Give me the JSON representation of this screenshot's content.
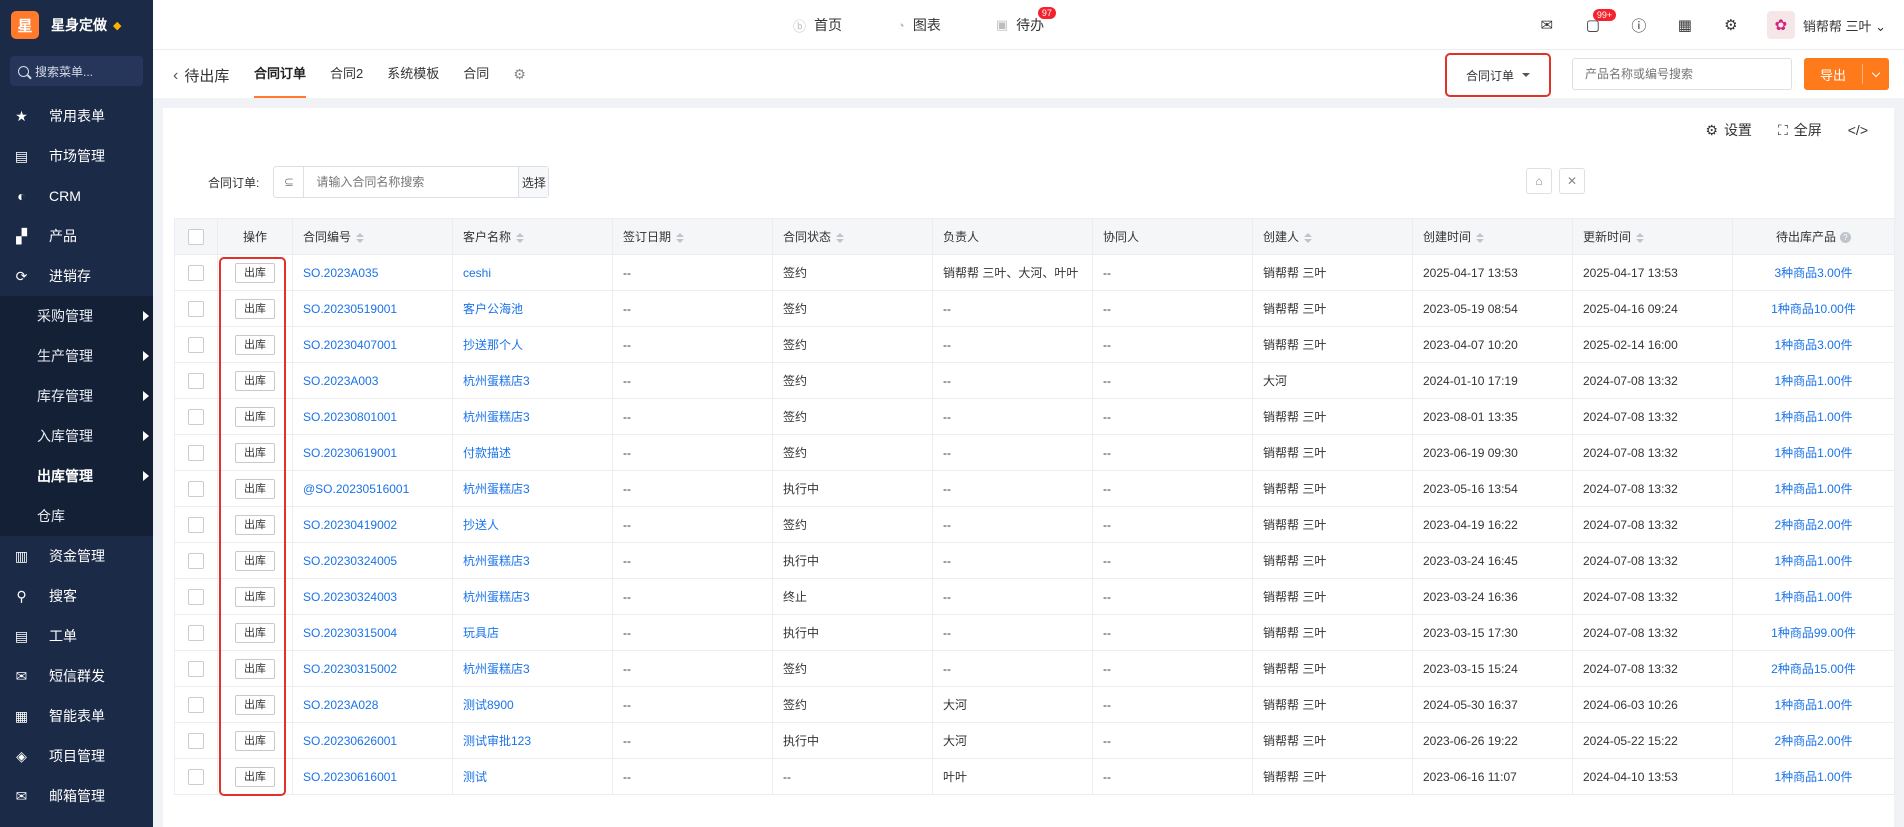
{
  "brand": {
    "logo_char": "星",
    "name": "星身定做"
  },
  "sidebar": {
    "search_placeholder": "搜索菜单...",
    "items": [
      {
        "label": "常用表单",
        "icon": "star-icon"
      },
      {
        "label": "市场管理",
        "icon": "clipboard-icon"
      },
      {
        "label": "CRM",
        "icon": "pie-icon"
      },
      {
        "label": "产品",
        "icon": "cube-icon"
      },
      {
        "label": "进销存",
        "icon": "refresh-icon"
      }
    ],
    "sub_items": [
      {
        "label": "采购管理",
        "arrow": true
      },
      {
        "label": "生产管理",
        "arrow": true
      },
      {
        "label": "库存管理",
        "arrow": true
      },
      {
        "label": "入库管理",
        "arrow": true
      },
      {
        "label": "出库管理",
        "arrow": true,
        "active": true
      },
      {
        "label": "仓库",
        "arrow": false
      }
    ],
    "items_after": [
      {
        "label": "资金管理",
        "icon": "wallet-icon"
      },
      {
        "label": "搜客",
        "icon": "search-icon"
      },
      {
        "label": "工单",
        "icon": "ticket-icon"
      },
      {
        "label": "短信群发",
        "icon": "envelope-icon"
      },
      {
        "label": "智能表单",
        "icon": "form-icon"
      },
      {
        "label": "项目管理",
        "icon": "layers-icon"
      },
      {
        "label": "邮箱管理",
        "icon": "mail-icon"
      }
    ]
  },
  "topbar": {
    "nav": [
      {
        "label": "首页",
        "icon": "home-icon"
      },
      {
        "label": "图表",
        "icon": "chart-icon"
      },
      {
        "label": "待办",
        "icon": "todo-icon",
        "badge": "97"
      }
    ],
    "message_badge": "99+",
    "user_name": "销帮帮 三叶"
  },
  "tabsbar": {
    "back_label": "待出库",
    "tabs": [
      "合同订单",
      "合同2",
      "系统模板",
      "合同"
    ],
    "active_tab": "合同订单",
    "dropdown_value": "合同订单",
    "search_placeholder": "产品名称或编号搜索",
    "export_label": "导出"
  },
  "toolbar": {
    "settings": "设置",
    "fullscreen": "全屏"
  },
  "filter": {
    "label": "合同订单:",
    "placeholder": "请输入合同名称搜索",
    "select_label": "选择"
  },
  "table": {
    "columns": [
      "操作",
      "合同编号",
      "客户名称",
      "签订日期",
      "合同状态",
      "负责人",
      "协同人",
      "创建人",
      "创建时间",
      "更新时间",
      "待出库产品"
    ],
    "op_label": "出库",
    "rows": [
      [
        "SO.2023A035",
        "ceshi",
        "--",
        "签约",
        "销帮帮 三叶、大河、叶叶",
        "--",
        "销帮帮 三叶",
        "2025-04-17 13:53",
        "2025-04-17 13:53",
        "3种商品3.00件"
      ],
      [
        "SO.20230519001",
        "客户公海池",
        "--",
        "签约",
        "--",
        "--",
        "销帮帮 三叶",
        "2023-05-19 08:54",
        "2025-04-16 09:24",
        "1种商品10.00件"
      ],
      [
        "SO.20230407001",
        "抄送那个人",
        "--",
        "签约",
        "--",
        "--",
        "销帮帮 三叶",
        "2023-04-07 10:20",
        "2025-02-14 16:00",
        "1种商品3.00件"
      ],
      [
        "SO.2023A003",
        "杭州蛋糕店3",
        "--",
        "签约",
        "--",
        "--",
        "大河",
        "2024-01-10 17:19",
        "2024-07-08 13:32",
        "1种商品1.00件"
      ],
      [
        "SO.20230801001",
        "杭州蛋糕店3",
        "--",
        "签约",
        "--",
        "--",
        "销帮帮 三叶",
        "2023-08-01 13:35",
        "2024-07-08 13:32",
        "1种商品1.00件"
      ],
      [
        "SO.20230619001",
        "付款描述",
        "--",
        "签约",
        "--",
        "--",
        "销帮帮 三叶",
        "2023-06-19 09:30",
        "2024-07-08 13:32",
        "1种商品1.00件"
      ],
      [
        "@SO.20230516001",
        "杭州蛋糕店3",
        "--",
        "执行中",
        "--",
        "--",
        "销帮帮 三叶",
        "2023-05-16 13:54",
        "2024-07-08 13:32",
        "1种商品1.00件"
      ],
      [
        "SO.20230419002",
        "抄送人",
        "--",
        "签约",
        "--",
        "--",
        "销帮帮 三叶",
        "2023-04-19 16:22",
        "2024-07-08 13:32",
        "2种商品2.00件"
      ],
      [
        "SO.20230324005",
        "杭州蛋糕店3",
        "--",
        "执行中",
        "--",
        "--",
        "销帮帮 三叶",
        "2023-03-24 16:45",
        "2024-07-08 13:32",
        "1种商品1.00件"
      ],
      [
        "SO.20230324003",
        "杭州蛋糕店3",
        "--",
        "终止",
        "--",
        "--",
        "销帮帮 三叶",
        "2023-03-24 16:36",
        "2024-07-08 13:32",
        "1种商品1.00件"
      ],
      [
        "SO.20230315004",
        "玩具店",
        "--",
        "执行中",
        "--",
        "--",
        "销帮帮 三叶",
        "2023-03-15 17:30",
        "2024-07-08 13:32",
        "1种商品99.00件"
      ],
      [
        "SO.20230315002",
        "杭州蛋糕店3",
        "--",
        "签约",
        "--",
        "--",
        "销帮帮 三叶",
        "2023-03-15 15:24",
        "2024-07-08 13:32",
        "2种商品15.00件"
      ],
      [
        "SO.2023A028",
        "测试8900",
        "--",
        "签约",
        "大河",
        "--",
        "销帮帮 三叶",
        "2024-05-30 16:37",
        "2024-06-03 10:26",
        "1种商品1.00件"
      ],
      [
        "SO.20230626001",
        "测试审批123",
        "--",
        "执行中",
        "大河",
        "--",
        "销帮帮 三叶",
        "2023-06-26 19:22",
        "2024-05-22 15:22",
        "2种商品2.00件"
      ],
      [
        "SO.20230616001",
        "测试",
        "--",
        "--",
        "叶叶",
        "--",
        "销帮帮 三叶",
        "2023-06-16 11:07",
        "2024-04-10 13:53",
        "1种商品1.00件"
      ]
    ]
  },
  "colors": {
    "sidebar_bg": "#1b2a47",
    "accent": "#ff7a1a",
    "link": "#1a73e8",
    "highlight": "#e0322b"
  }
}
